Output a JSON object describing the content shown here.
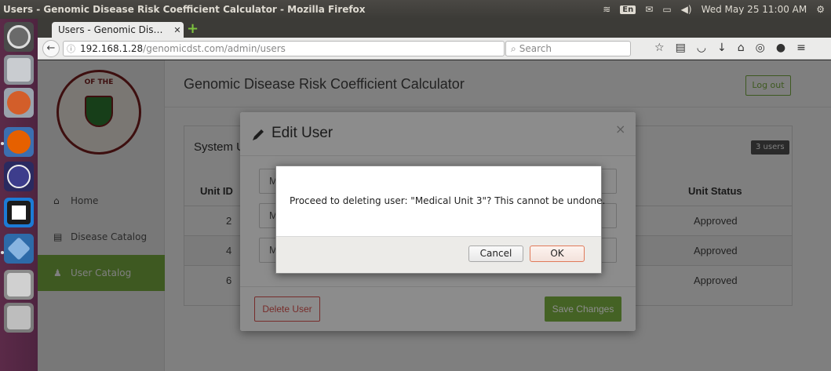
{
  "window_title": "Users - Genomic Disease Risk Coefficient Calculator - Mozilla Firefox",
  "top_panel": {
    "keyboard_layout": "En",
    "clock": "Wed May 25 11:00 AM"
  },
  "browser": {
    "tab_title": "Users - Genomic Dis…",
    "url_host": "192.168.1.28",
    "url_path": "/genomicdst.com/admin/users",
    "search_placeholder": "Search"
  },
  "app": {
    "title": "Genomic Disease Risk Coefficient Calculator",
    "logout_label": "Log out",
    "seal_text": "OF THE"
  },
  "sidebar": {
    "items": [
      {
        "label": "Home",
        "icon": "home-icon"
      },
      {
        "label": "Disease Catalog",
        "icon": "document-icon"
      },
      {
        "label": "User Catalog",
        "icon": "users-icon"
      }
    ]
  },
  "panel": {
    "title": "System Users",
    "badge": "3 users",
    "columns": {
      "unit_id": "Unit ID",
      "unit_status": "Unit Status"
    },
    "rows": [
      {
        "unit_id": "2",
        "status": "Approved"
      },
      {
        "unit_id": "4",
        "status": "Approved"
      },
      {
        "unit_id": "6",
        "status": "Approved"
      }
    ]
  },
  "modal": {
    "title": "Edit User",
    "fields": [
      "M",
      "M",
      "M"
    ],
    "delete_label": "Delete User",
    "save_label": "Save Changes",
    "close_glyph": "×"
  },
  "confirm": {
    "message": "Proceed to deleting user: \"Medical Unit 3\"? This cannot be undone.",
    "cancel_label": "Cancel",
    "ok_label": "OK"
  },
  "colors": {
    "accent_green": "#7cb342",
    "danger_red": "#d9534f",
    "launcher": "#5b2a48"
  }
}
